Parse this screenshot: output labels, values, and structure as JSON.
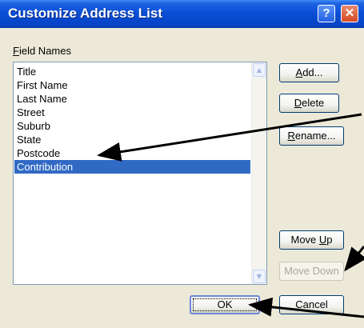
{
  "window": {
    "title": "Customize Address List",
    "help_glyph": "?",
    "close_glyph": "✕"
  },
  "field_names": {
    "label": "Field Names",
    "items": [
      "Title",
      "First Name",
      "Last Name",
      "Street",
      "Suburb",
      "State",
      "Postcode",
      "Contribution"
    ],
    "selected_index": 7
  },
  "buttons": {
    "add": "Add...",
    "delete": "Delete",
    "rename": "Rename...",
    "move_up": "Move Up",
    "move_down": "Move Down",
    "ok": "OK",
    "cancel": "Cancel"
  },
  "icons": {
    "scroll_up": "scroll-up-arrow",
    "scroll_down": "scroll-down-arrow",
    "annotation": "annotation-arrow"
  },
  "colors": {
    "title_bar": "#0a4fd6",
    "selection": "#316ac5",
    "annotation": "#000000"
  }
}
